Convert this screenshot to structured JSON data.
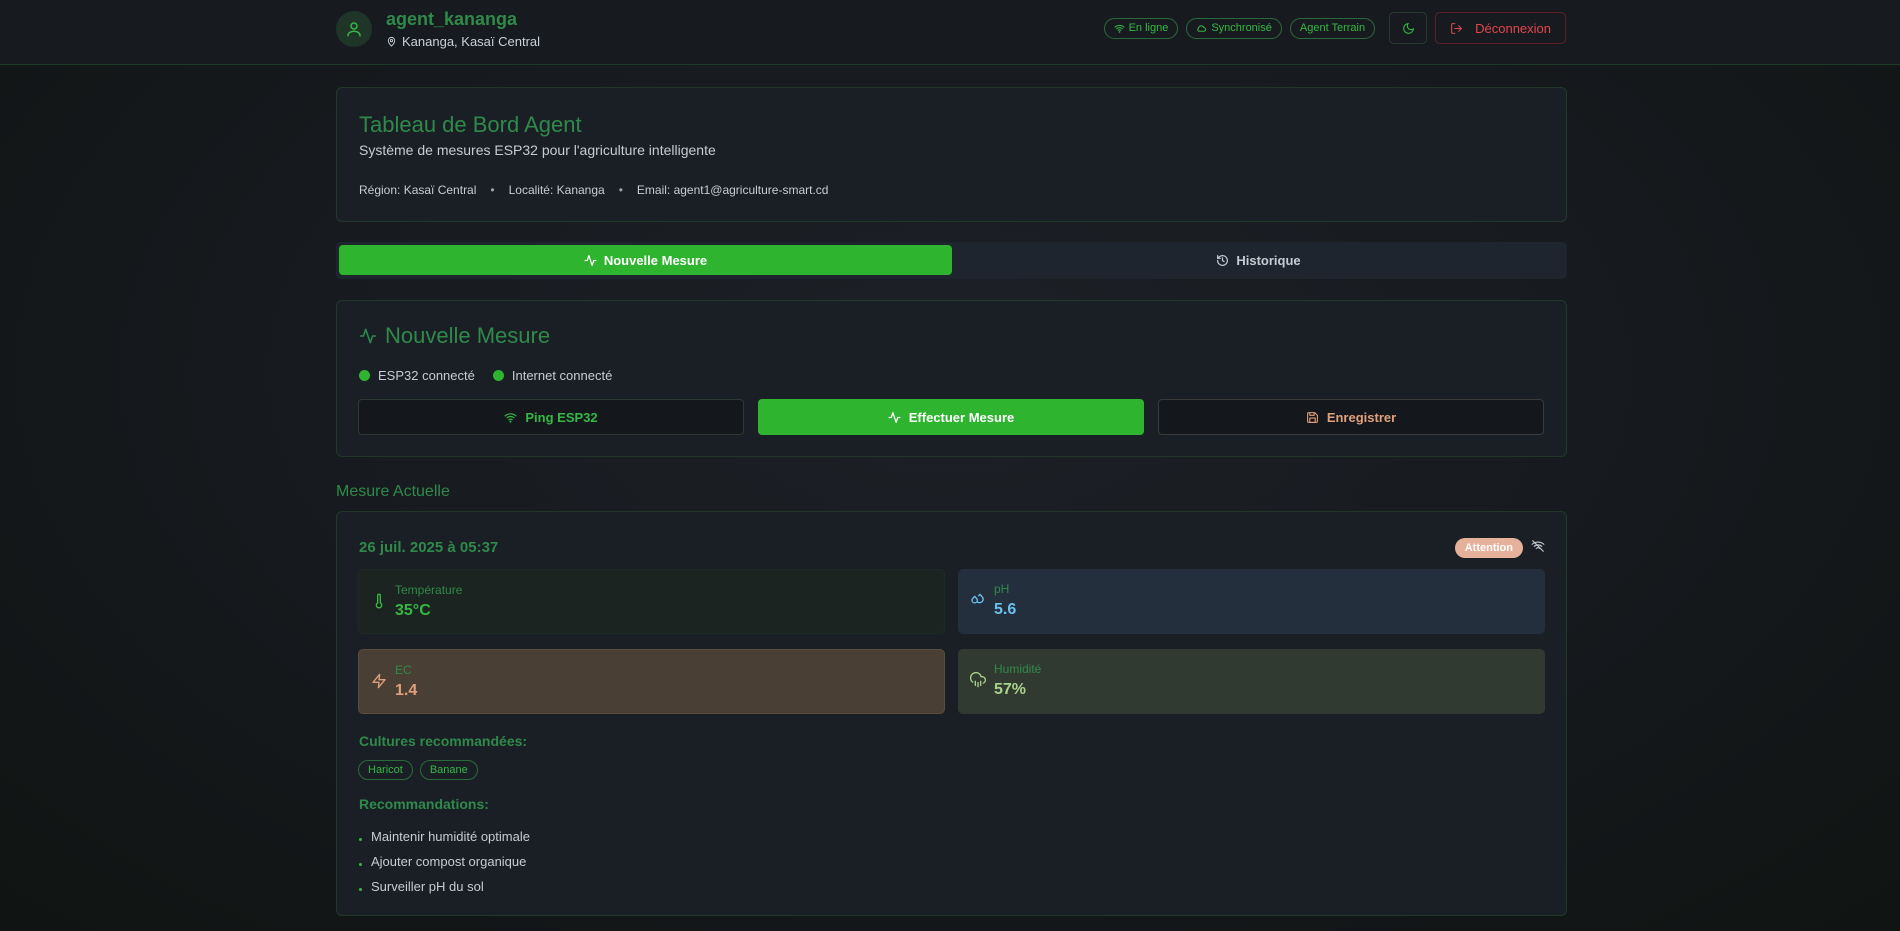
{
  "header": {
    "username": "agent_kananga",
    "location": "Kananga, Kasaï Central",
    "badges": {
      "online": "En ligne",
      "synced": "Synchronisé",
      "role": "Agent Terrain"
    },
    "logout_label": "Déconnexion"
  },
  "intro": {
    "title": "Tableau de Bord Agent",
    "subtitle": "Système de mesures ESP32 pour l'agriculture intelligente",
    "region": "Région: Kasaï Central",
    "locality": "Localité: Kananga",
    "email": "Email: agent1@agriculture-smart.cd",
    "separator": "•"
  },
  "tabs": {
    "new_measure": "Nouvelle Mesure",
    "history": "Historique"
  },
  "measure": {
    "title": "Nouvelle Mesure",
    "esp_status": "ESP32 connecté",
    "internet_status": "Internet connecté",
    "ping_label": "Ping ESP32",
    "effect_label": "Effectuer Mesure",
    "save_label": "Enregistrer"
  },
  "current": {
    "section_title": "Mesure Actuelle",
    "date": "26 juil. 2025 à 05:37",
    "status_badge": "Attention",
    "tiles": {
      "temperature": {
        "label": "Température",
        "value": "35°C"
      },
      "ph": {
        "label": "pH",
        "value": "5.6"
      },
      "ec": {
        "label": "EC",
        "value": "1.4"
      },
      "humidity": {
        "label": "Humidité",
        "value": "57%"
      }
    },
    "crops_title": "Cultures recommandées:",
    "crops": [
      "Haricot",
      "Banane"
    ],
    "recs_title": "Recommandations:",
    "recommendations": [
      "Maintenir humidité optimale",
      "Ajouter compost organique",
      "Surveiller pH du sol"
    ]
  },
  "colors": {
    "accent_green": "#2fb42f",
    "title_green": "#2f8a4a",
    "danger": "#e2454b",
    "warning": "#e6b19a"
  }
}
